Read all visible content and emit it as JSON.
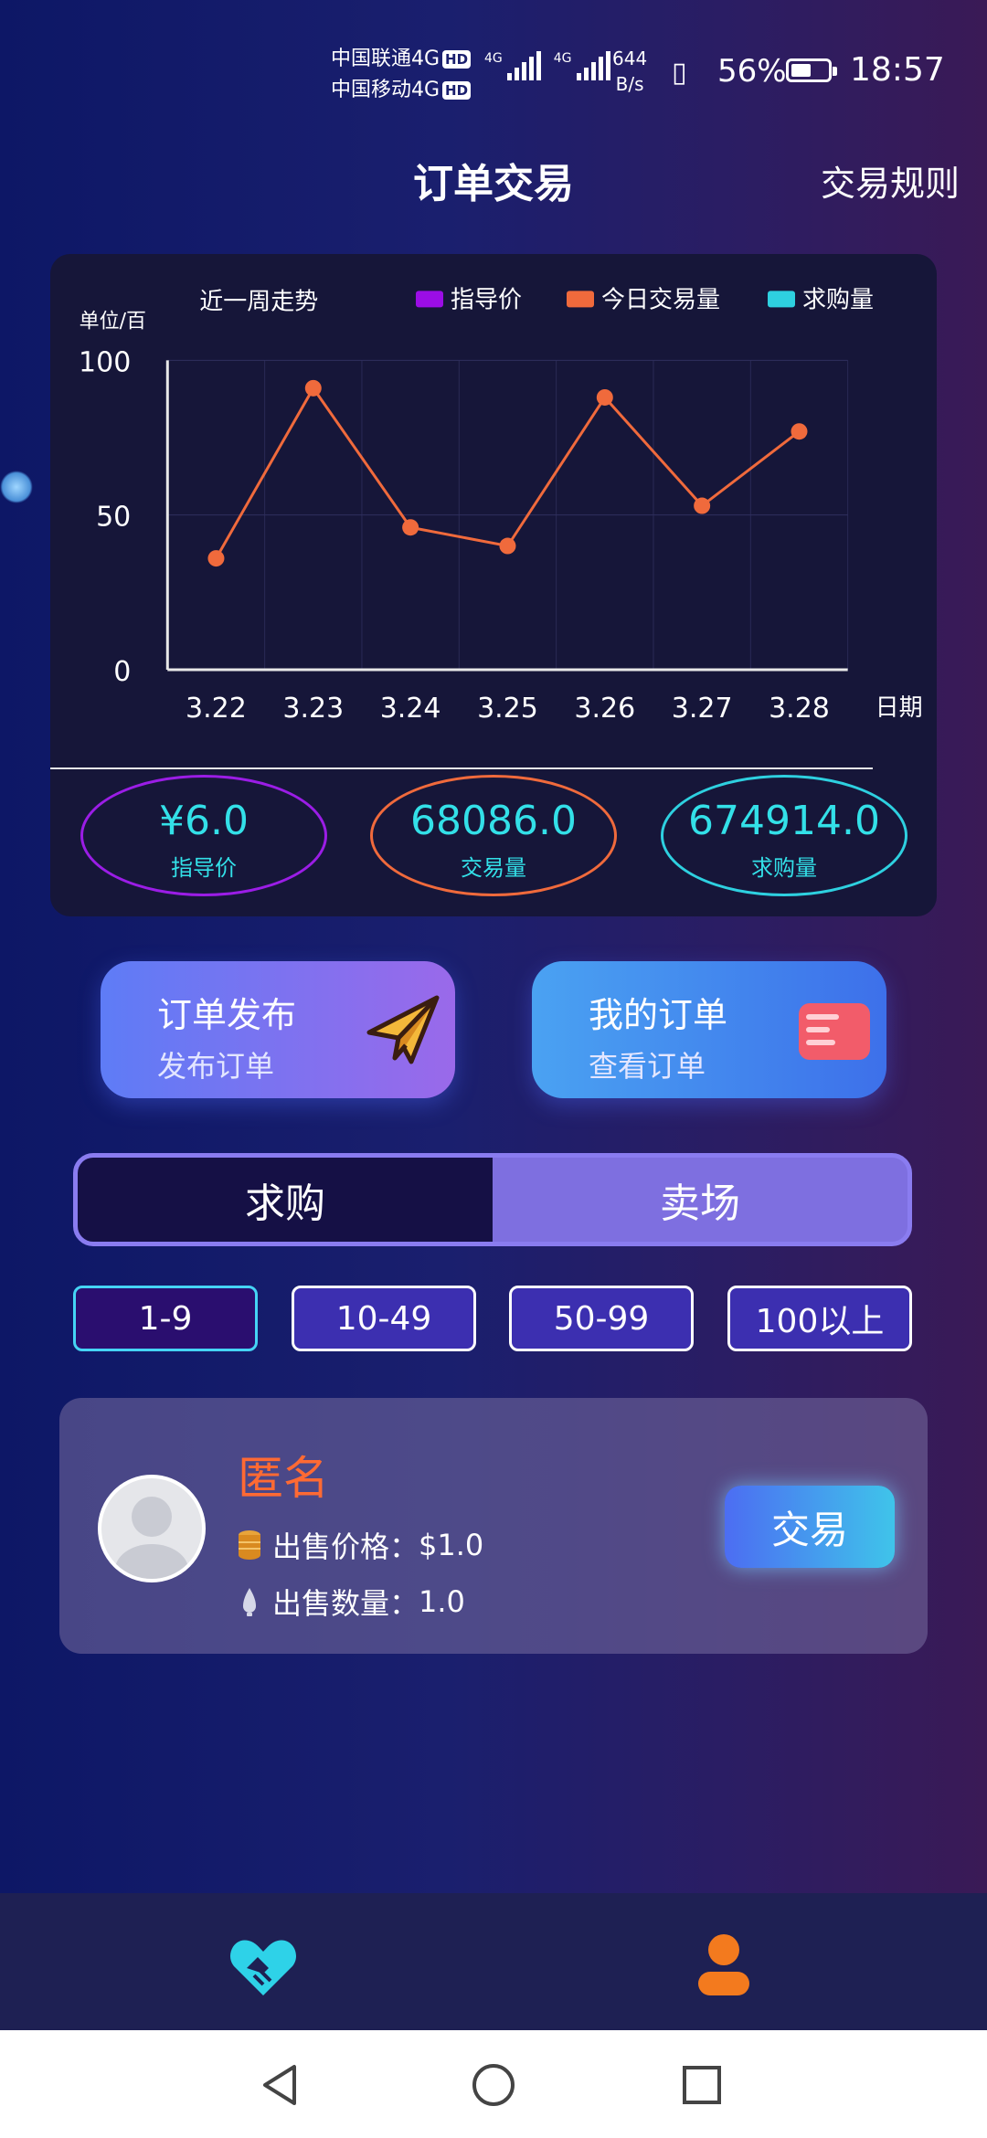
{
  "status": {
    "carrier1": "中国联通4G",
    "carrier2": "中国移动4G",
    "hd": "HD",
    "net_tag": "4G",
    "speed_value": "644",
    "speed_unit": "B/s",
    "battery": "56%",
    "battery_level": 0.56,
    "time": "18:57"
  },
  "header": {
    "title": "订单交易",
    "rules": "交易规则"
  },
  "chart_data": {
    "type": "line",
    "title": "近一周走势",
    "ylabel": "单位/百",
    "xlabel": "日期",
    "ylim": [
      0,
      100
    ],
    "yticks": [
      "100",
      "50",
      "0"
    ],
    "categories": [
      "3.22",
      "3.23",
      "3.24",
      "3.25",
      "3.26",
      "3.27",
      "3.28"
    ],
    "legend": [
      {
        "name": "指导价",
        "color": "#9b0de6"
      },
      {
        "name": "今日交易量",
        "color": "#f06a3c"
      },
      {
        "name": "求购量",
        "color": "#2ed0e0"
      }
    ],
    "series": [
      {
        "name": "今日交易量",
        "values": [
          36,
          91,
          46,
          40,
          88,
          53,
          77
        ],
        "color": "#f06a3c"
      }
    ],
    "grid": true,
    "legend_position": "top-right"
  },
  "stats": [
    {
      "value": "¥6.0",
      "label": "指导价",
      "color": "#9b1de6",
      "text": "#33e0e8"
    },
    {
      "value": "68086.0",
      "label": "交易量",
      "color": "#f06a3c",
      "text": "#33e0e8"
    },
    {
      "value": "674914.0",
      "label": "求购量",
      "color": "#2ed0e0",
      "text": "#33e0e8"
    }
  ],
  "actions": {
    "publish": {
      "title": "订单发布",
      "sub": "发布订单"
    },
    "mine": {
      "title": "我的订单",
      "sub": "查看订单"
    }
  },
  "tabs": {
    "buy": "求购",
    "sell": "卖场"
  },
  "quantity_filters": [
    "1-9",
    "10-49",
    "50-99",
    "100以上"
  ],
  "order": {
    "name": "匿名",
    "price_label": "出售价格：",
    "price": "$1.0",
    "qty_label": "出售数量：",
    "qty": "1.0",
    "trade_button": "交易"
  },
  "nav": {
    "left_icon": "handshake-icon",
    "right_icon": "user-icon"
  }
}
